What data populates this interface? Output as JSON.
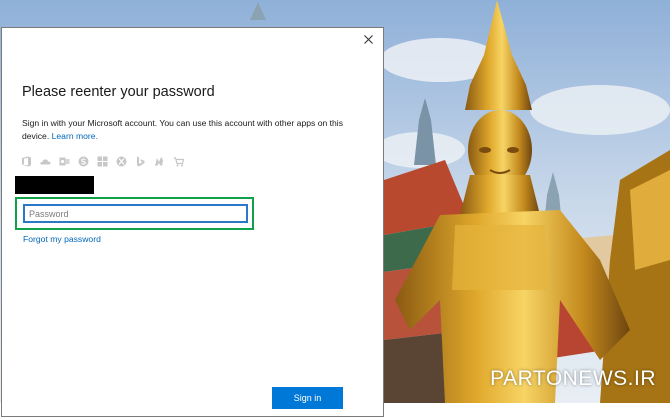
{
  "dialog": {
    "title": "Please reenter your password",
    "description": "Sign in with your Microsoft account. You can use this account with other apps on this device.",
    "learn_more": "Learn more.",
    "password_placeholder": "Password",
    "password_value": "",
    "forgot_link": "Forgot my password",
    "signin_label": "Sign in",
    "app_icons": [
      "office-icon",
      "onedrive-icon",
      "outlook-icon",
      "skype-icon",
      "windows-icon",
      "xbox-icon",
      "bing-icon",
      "msn-icon",
      "store-icon"
    ]
  },
  "watermark": "PARTONEWS.IR",
  "colors": {
    "accent": "#0078d7",
    "link": "#0067b8",
    "highlight": "#12a14b",
    "input_border": "#2b78c6"
  }
}
